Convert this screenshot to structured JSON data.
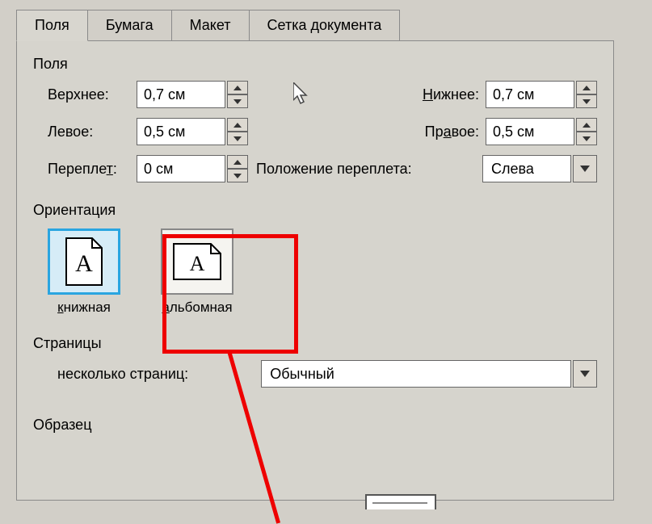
{
  "tabs": {
    "fields": "Поля",
    "paper": "Бумага",
    "layout": "Макет",
    "grid": "Сетка документа"
  },
  "group_fields": "Поля",
  "margins": {
    "top_label": "Верхнее:",
    "top_value": "0,7 см",
    "bottom_label_prefix": "Н",
    "bottom_label_rest": "ижнее:",
    "bottom_value": "0,7 см",
    "left_label": "Левое:",
    "left_value": "0,5 см",
    "right_label_prefix": "Пр",
    "right_label_letter": "а",
    "right_label_rest": "вое:",
    "right_value": "0,5 см",
    "gutter_label": "Перепле",
    "gutter_letter": "т",
    "gutter_colon": ":",
    "gutter_value": "0 см",
    "gutter_pos_label": "Положение переплета:",
    "gutter_pos_value": "Слева"
  },
  "orientation": {
    "group": "Ориентация",
    "portrait_prefix": "к",
    "portrait_rest": "нижная",
    "landscape_prefix": "а",
    "landscape_rest": "льбомная"
  },
  "pages": {
    "group": "Страницы",
    "multi_label": "несколько страниц:",
    "multi_value": "Обычный"
  },
  "preview": {
    "group": "Образец"
  }
}
